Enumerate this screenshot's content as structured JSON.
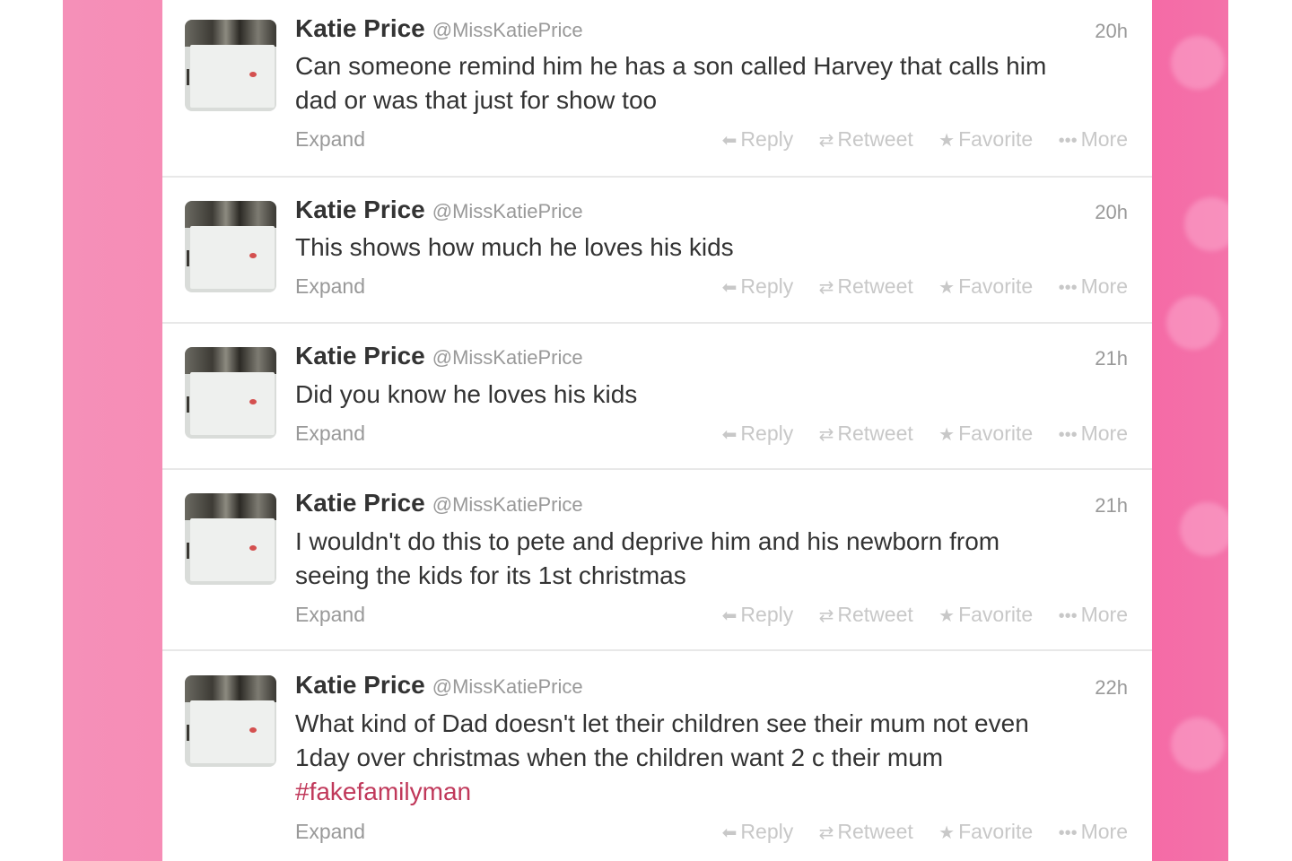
{
  "colors": {
    "background_pink": "#f68cb6",
    "hashtag": "#c0385a",
    "name_text": "#333333",
    "meta_text": "#999999"
  },
  "tweets": [
    {
      "name": "Katie Price",
      "handle": "@MissKatiePrice",
      "time": "20h",
      "lines": [
        "Can someone remind him he has a son called Harvey that calls him",
        "dad or was that just for show too"
      ],
      "hashtag": "",
      "expand": "Expand"
    },
    {
      "name": "Katie Price",
      "handle": "@MissKatiePrice",
      "time": "20h",
      "lines": [
        "This shows how much he loves his kids"
      ],
      "hashtag": "",
      "expand": "Expand"
    },
    {
      "name": "Katie Price",
      "handle": "@MissKatiePrice",
      "time": "21h",
      "lines": [
        "Did you know he loves his kids"
      ],
      "hashtag": "",
      "expand": "Expand"
    },
    {
      "name": "Katie Price",
      "handle": "@MissKatiePrice",
      "time": "21h",
      "lines": [
        "I wouldn't do this to pete and deprive him and his newborn from",
        "seeing the kids for its 1st christmas"
      ],
      "hashtag": "",
      "expand": "Expand"
    },
    {
      "name": "Katie Price",
      "handle": "@MissKatiePrice",
      "time": "22h",
      "lines": [
        "What kind of Dad doesn't let their children see their mum not even",
        "1day over christmas when the children want 2 c their mum"
      ],
      "hashtag": "#fakefamilyman",
      "expand": "Expand"
    }
  ],
  "actions": {
    "reply": "Reply",
    "retweet": "Retweet",
    "favorite": "Favorite",
    "more": "More",
    "reply_icon": "reply-arrow-icon",
    "retweet_icon": "retweet-icon",
    "favorite_icon": "star-icon",
    "more_icon": "ellipsis-icon"
  }
}
